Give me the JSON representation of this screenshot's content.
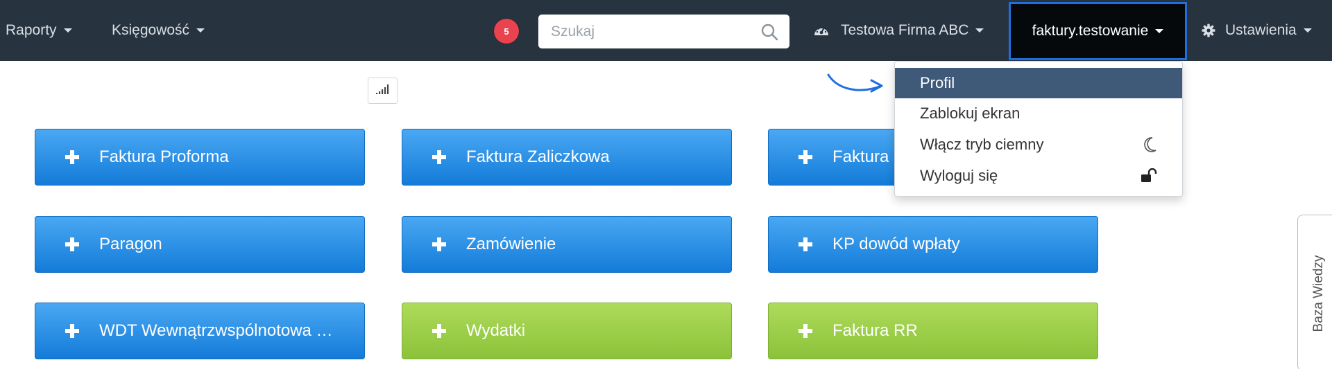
{
  "nav": {
    "reports_label": "Raporty",
    "accounting_label": "Księgowość",
    "notifications_count": "5",
    "search": {
      "placeholder": "Szukaj",
      "value": ""
    },
    "company_label": "Testowa Firma ABC",
    "user_label": "faktury.testowanie",
    "settings_label": "Ustawienia"
  },
  "user_dropdown": {
    "items": [
      {
        "label": "Profil",
        "active": true
      },
      {
        "label": "Zablokuj ekran"
      },
      {
        "label": "Włącz tryb ciemny",
        "icon": "moon-icon"
      },
      {
        "label": "Wyloguj się",
        "icon": "unlock-icon"
      }
    ]
  },
  "tiles": [
    {
      "label": "Faktura Proforma",
      "color": "blue"
    },
    {
      "label": "Faktura Zaliczkowa",
      "color": "blue"
    },
    {
      "label": "Faktura",
      "color": "blue"
    },
    {
      "label": "Paragon",
      "color": "blue"
    },
    {
      "label": "Zamówienie",
      "color": "blue"
    },
    {
      "label": "KP dowód wpłaty",
      "color": "blue"
    },
    {
      "label": "WDT Wewnątrzwspólnotowa …",
      "color": "blue"
    },
    {
      "label": "Wydatki",
      "color": "green"
    },
    {
      "label": "Faktura RR",
      "color": "green"
    }
  ],
  "knowledge_base_label": "Baza Wiedzy",
  "colors": {
    "nav_bg": "#27333f",
    "user_menu_bg": "#06090c",
    "user_menu_border": "#1f6fe0",
    "badge": "#e8434e",
    "tile_blue": "#1f86e2",
    "tile_green": "#9acd49",
    "dropdown_active": "#3f5a78"
  }
}
